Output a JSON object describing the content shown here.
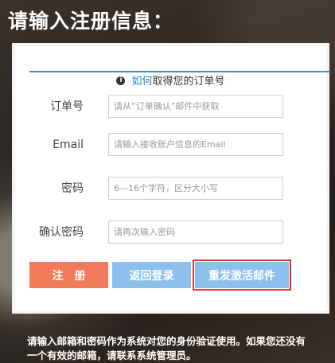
{
  "page": {
    "title": "请输入注册信息："
  },
  "form": {
    "help_icon": "info-icon",
    "help_link": "如何",
    "help_text": "取得您的订单号",
    "fields": [
      {
        "label": "订单号",
        "placeholder": "请从“订单确认”邮件中获取",
        "value": ""
      },
      {
        "label": "Email",
        "placeholder": "请输入接收账户信息的Email",
        "value": ""
      },
      {
        "label": "密码",
        "placeholder": "6—16个字符，区分大小写",
        "value": ""
      },
      {
        "label": "确认密码",
        "placeholder": "请再次输入密码",
        "value": ""
      }
    ],
    "buttons": {
      "register": "注册",
      "login": "返回登录",
      "resend": "重发激活邮件"
    }
  },
  "footer": {
    "text": "请输入邮箱和密码作为系统对您的身份验证使用。如果您还没有一个有效的邮箱，请联系系统管理员。"
  },
  "colors": {
    "accent_line": "#3a8fc4",
    "register_button": "#f07a5a",
    "secondary_button": "#8dc0ec",
    "highlight_border": "#e0332e",
    "link": "#2a7fc0"
  }
}
